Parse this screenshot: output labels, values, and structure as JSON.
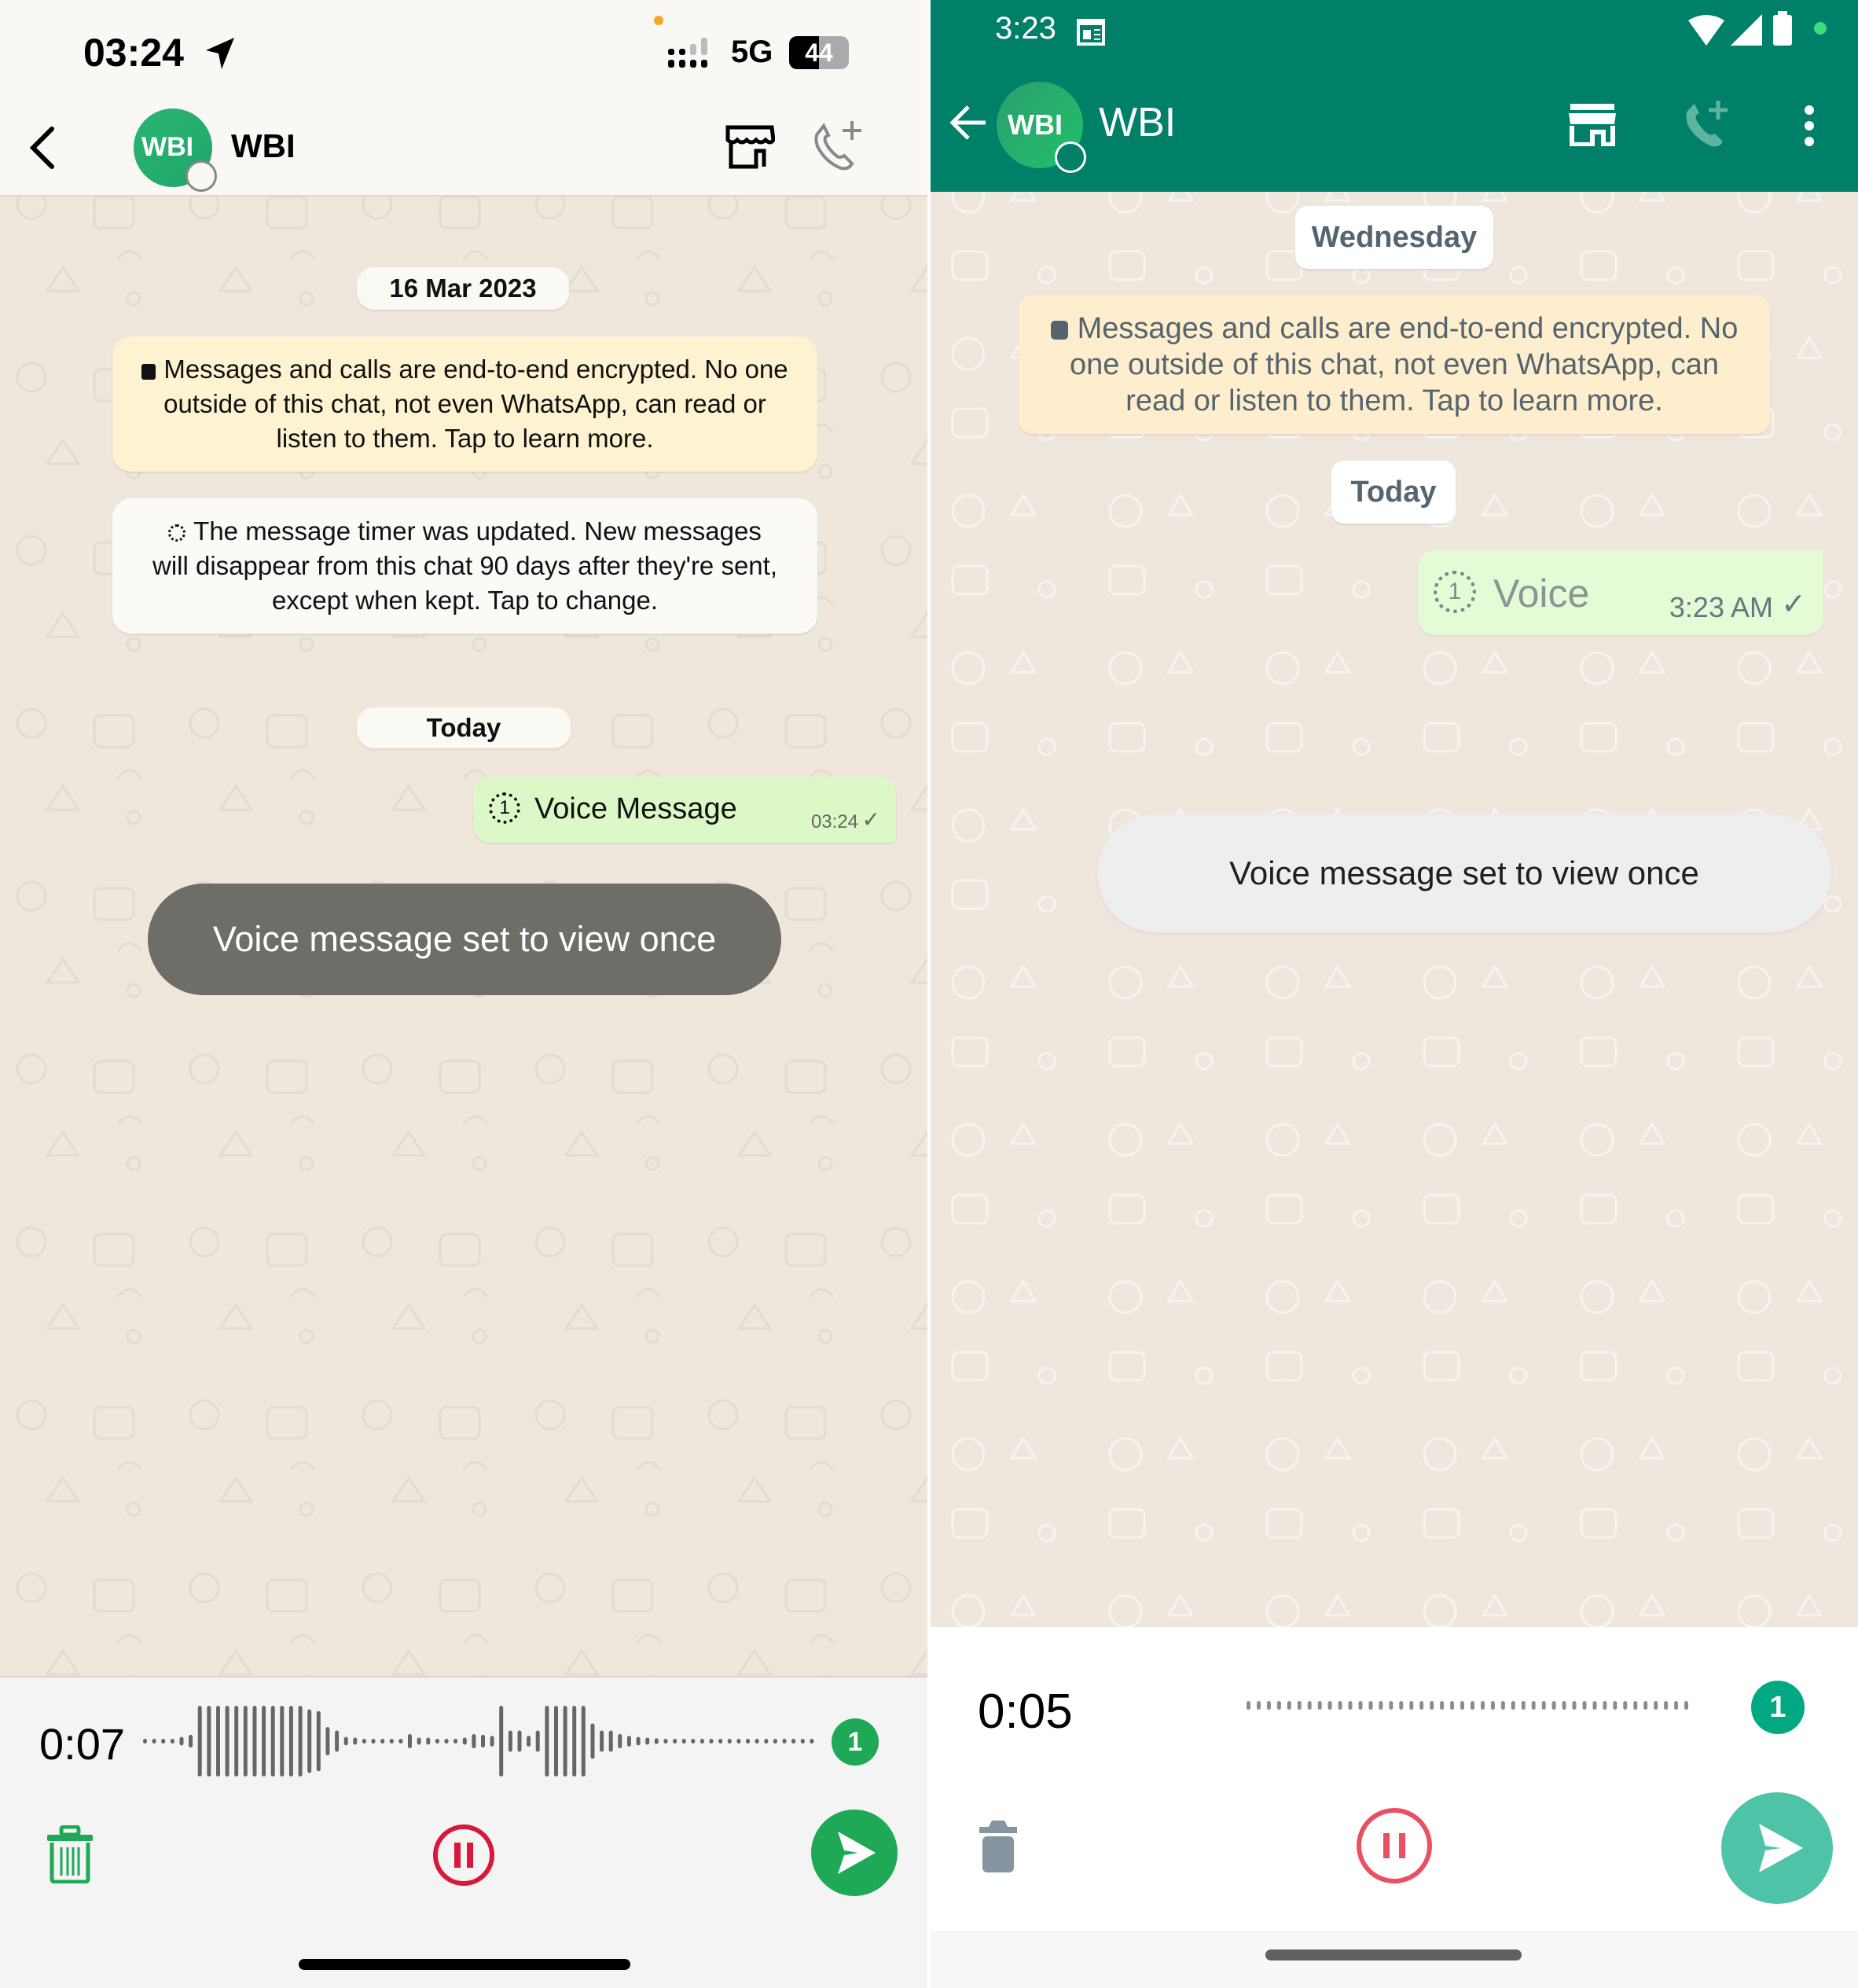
{
  "left": {
    "status_bar": {
      "time": "03:24",
      "network": "5G",
      "battery": "44",
      "location_icon": "location-arrow-icon",
      "signal_icon": "signal-bars-icon"
    },
    "header": {
      "contact_name": "WBI",
      "avatar_text": "WBI",
      "back_icon": "chevron-left-icon",
      "store_icon": "storefront-icon",
      "call_icon": "add-call-icon"
    },
    "chat": {
      "date_pill_1": "16 Mar 2023",
      "encryption_notice": "Messages and calls are end-to-end encrypted. No one outside of this chat, not even WhatsApp, can read or listen to them. Tap to learn more.",
      "timer_notice": "The message timer was updated. New messages will disappear from this chat 90 days after they're sent, except when kept. Tap to change.",
      "date_pill_2": "Today",
      "message": {
        "text": "Voice Message",
        "time": "03:24",
        "status": "sent"
      },
      "toast": "Voice message set to view once"
    },
    "recorder": {
      "duration": "0:07",
      "view_once_badge": "1",
      "delete_icon": "trash-icon",
      "pause_icon": "pause-icon",
      "send_icon": "send-icon",
      "waveform": [
        0.05,
        0.05,
        0.05,
        0.05,
        0.12,
        0.18,
        1,
        1,
        1,
        1,
        1,
        1,
        1,
        1,
        1,
        1,
        1,
        1,
        0.9,
        0.85,
        0.4,
        0.3,
        0.12,
        0.1,
        0.05,
        0.05,
        0.05,
        0.05,
        0.05,
        0.2,
        0.1,
        0.1,
        0.05,
        0.05,
        0.05,
        0.1,
        0.2,
        0.18,
        0.15,
        1,
        0.3,
        0.3,
        0.15,
        0.3,
        1,
        1,
        1,
        1,
        1,
        0.5,
        0.3,
        0.3,
        0.2,
        0.15,
        0.12,
        0.1,
        0.08,
        0.05,
        0.05,
        0.05,
        0.05,
        0.05,
        0.05,
        0.05,
        0.05,
        0.05,
        0.05,
        0.05,
        0.05,
        0.05,
        0.05,
        0.05,
        0.05,
        0.05
      ]
    },
    "colors": {
      "accent": "#1fa855",
      "pause": "#d9173b",
      "bubble": "#dcf8c6",
      "encryption_bg": "#fdf3d1"
    }
  },
  "right": {
    "status_bar": {
      "time": "3:23",
      "calendar_icon": "calendar-icon",
      "wifi_icon": "wifi-icon",
      "signal_icon": "signal-icon",
      "battery_icon": "battery-icon"
    },
    "header": {
      "contact_name": "WBI",
      "avatar_text": "WBI",
      "back_icon": "arrow-left-icon",
      "store_icon": "storefront-icon",
      "call_icon": "add-call-icon",
      "menu_icon": "more-vert-icon"
    },
    "chat": {
      "date_pill_1": "Wednesday",
      "encryption_notice": "Messages and calls are end-to-end encrypted. No one outside of this chat, not even WhatsApp, can read or listen to them. Tap to learn more.",
      "date_pill_2": "Today",
      "message": {
        "text": "Voice",
        "time": "3:23 AM",
        "status": "sent"
      },
      "toast": "Voice message set to view once"
    },
    "recorder": {
      "duration": "0:05",
      "view_once_badge": "1",
      "delete_icon": "trash-icon",
      "pause_icon": "pause-icon",
      "send_icon": "send-icon",
      "dots": 44
    },
    "colors": {
      "header": "#008069",
      "accent": "#00a884",
      "pause": "#ea4f63",
      "send": "#4fc3a8"
    }
  }
}
